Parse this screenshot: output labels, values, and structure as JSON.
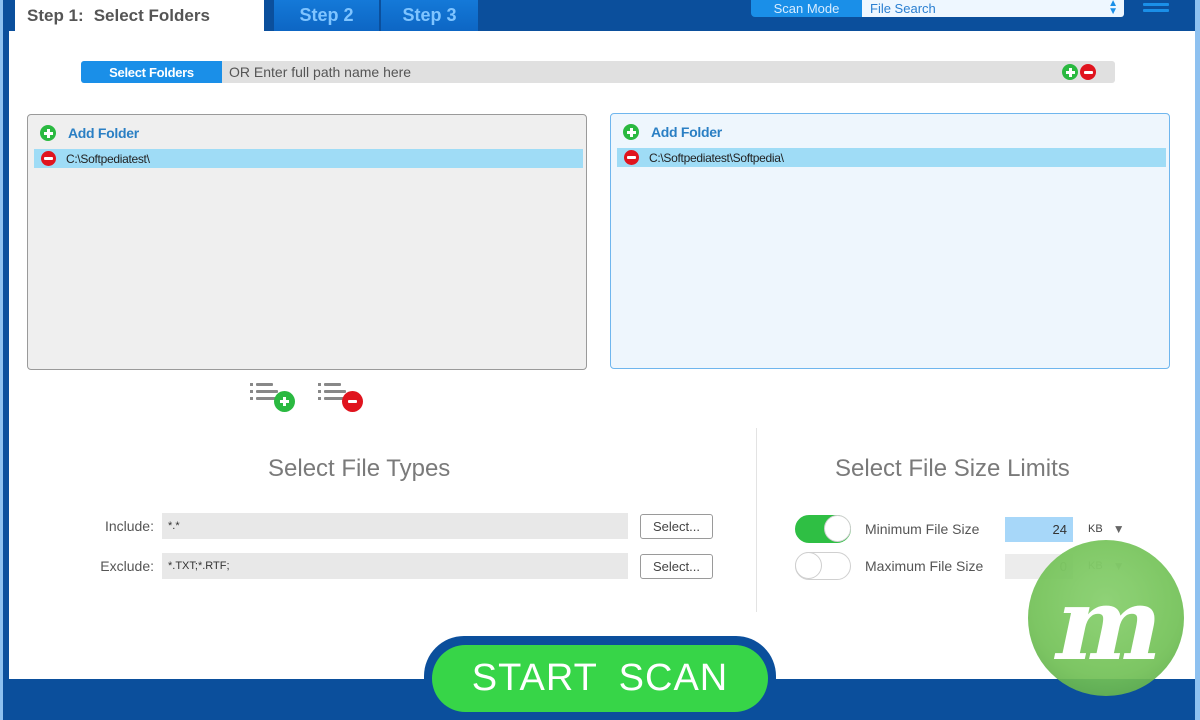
{
  "header": {
    "step1_number": "Step 1:",
    "step1_label": "Select Folders",
    "step2_label": "Step 2",
    "step3_label": "Step 3",
    "scan_mode_label": "Scan Mode",
    "scan_mode_value": "File Search",
    "menu_icon": "hamburger-menu-icon"
  },
  "path_bar": {
    "select_folders_label": "Select Folders",
    "placeholder": "OR Enter full path name here",
    "add_icon": "plus-circle-icon",
    "remove_icon": "minus-circle-icon"
  },
  "folders": {
    "left": {
      "add_folder_label": "Add Folder",
      "items": [
        {
          "path": "C:\\Softpediatest\\"
        }
      ]
    },
    "right": {
      "add_folder_label": "Add Folder",
      "items": [
        {
          "path": "C:\\Softpediatest\\Softpedia\\"
        }
      ]
    },
    "add_list_icon": "list-add-icon",
    "remove_list_icon": "list-remove-icon"
  },
  "file_types": {
    "title": "Select File Types",
    "include_label": "Include:",
    "include_value": "*.*",
    "exclude_label": "Exclude:",
    "exclude_value": "*.TXT;*.RTF;",
    "select_button_label": "Select..."
  },
  "size_limits": {
    "title": "Select File Size Limits",
    "min": {
      "label": "Minimum File Size",
      "enabled": true,
      "value": "24",
      "unit": "KB"
    },
    "max": {
      "label": "Maximum File Size",
      "enabled": false,
      "value": "0",
      "unit": "KB"
    }
  },
  "actions": {
    "start_scan_label": "START  SCAN"
  },
  "colors": {
    "primary_blue": "#0b4f9c",
    "accent_blue": "#1a8fe8",
    "green": "#37d548",
    "red": "#e0141e",
    "selection": "#9fdcf6"
  }
}
